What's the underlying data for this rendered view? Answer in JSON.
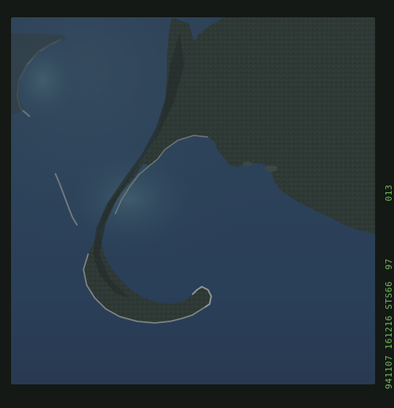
{
  "photo": {
    "description_hidden": "",
    "colors": {
      "frame": "#141915",
      "water": "#2c4259",
      "land": "#2f3a36",
      "land_dark": "#27302e",
      "beach": "#7c8380",
      "annotation_text": "#6fbf55"
    }
  },
  "annotation": {
    "text": "941107 161216 STS66  97          013"
  }
}
